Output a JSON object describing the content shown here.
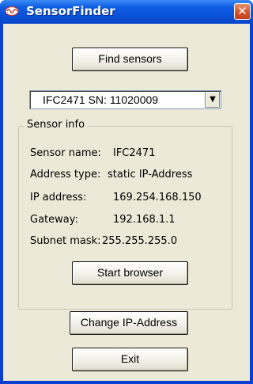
{
  "window": {
    "title": "SensorFinder",
    "close_glyph": "✕"
  },
  "buttons": {
    "find": "Find sensors",
    "start_browser": "Start browser",
    "change_ip": "Change IP-Address",
    "exit": "Exit"
  },
  "sensor_select": {
    "value": "IFC2471 SN: 11020009",
    "arrow": "▼"
  },
  "sensor_info": {
    "legend": "Sensor info",
    "rows": [
      {
        "label": "Sensor name:",
        "value": "IFC2471"
      },
      {
        "label": "Address type:",
        "value": "static IP-Address"
      },
      {
        "label": "IP address:",
        "value": "169.254.168.150"
      },
      {
        "label": "Gateway:",
        "value": "192.168.1.1"
      },
      {
        "label": "Subnet mask:",
        "value": "255.255.255.0"
      }
    ]
  },
  "colors": {
    "titlebar": "#0a50d6",
    "client": "#ece9d8",
    "close_button": "#d2552e"
  }
}
